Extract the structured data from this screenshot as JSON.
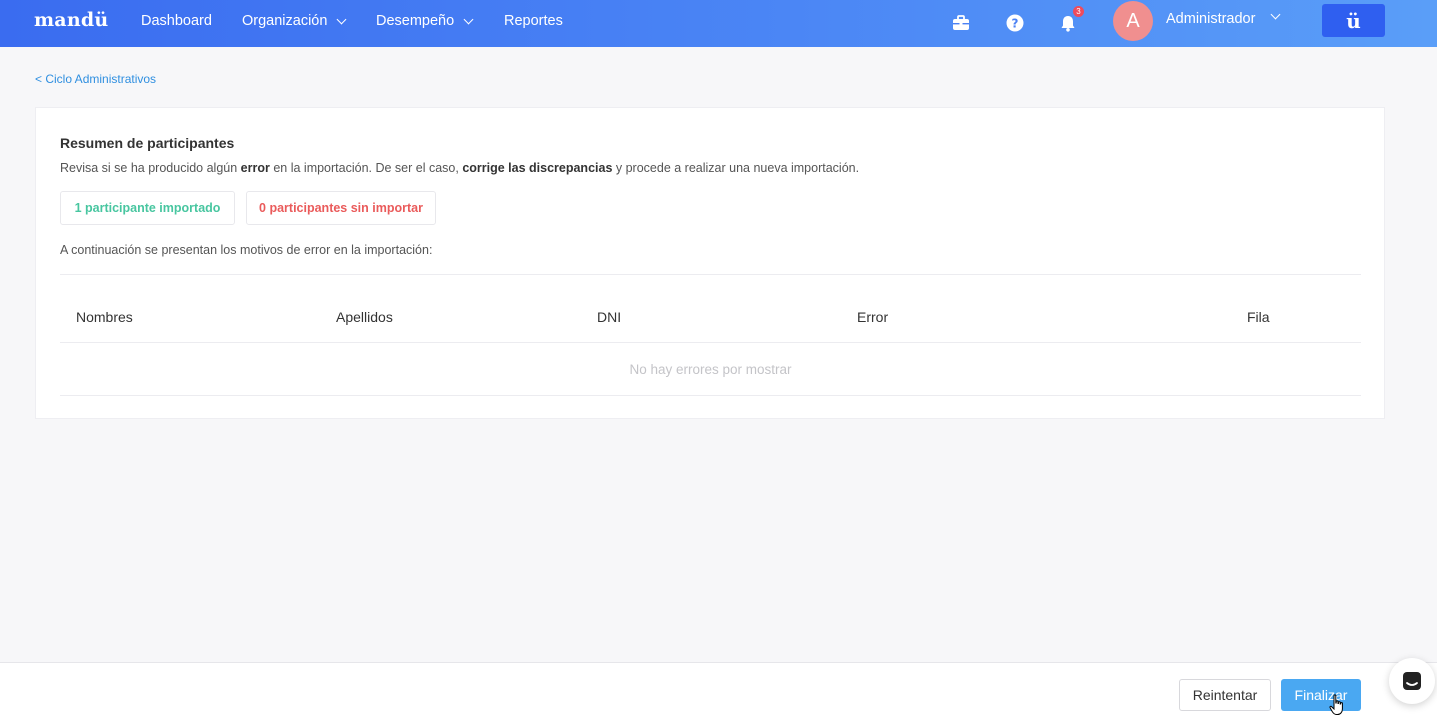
{
  "header": {
    "logo": "mandü",
    "nav": [
      {
        "label": "Dashboard"
      },
      {
        "label": "Organización"
      },
      {
        "label": "Desempeño"
      },
      {
        "label": "Reportes"
      }
    ],
    "notifications_count": "3",
    "avatar_initial": "A",
    "user_name": "Administrador",
    "brand_button": "ü",
    "colors": {
      "bar_start": "#3a6cf0",
      "bar_end": "#5a9ef8",
      "brand_btn": "#2f5ff0",
      "avatar": "#f08f8f"
    }
  },
  "breadcrumb": "< Ciclo Administrativos",
  "summary": {
    "title": "Resumen de participantes",
    "desc_1": "Revisa si se ha producido algún ",
    "desc_bold_1": "error",
    "desc_2": " en la importación. De ser el caso, ",
    "desc_bold_2": "corrige las discrepancias",
    "desc_3": " y procede a realizar una nueva importación.",
    "imported": "1 participante importado",
    "not_imported": "0 participantes sin importar",
    "subtitle": "A continuación se presentan los motivos de error en la importación:",
    "colors": {
      "imported": "#48c6a0",
      "not_imported": "#ea5b5b"
    }
  },
  "table": {
    "columns": [
      "Nombres",
      "Apellidos",
      "DNI",
      "Error",
      "Fila"
    ],
    "empty": "No hay errores por mostrar"
  },
  "footer": {
    "retry": "Reintentar",
    "finish": "Finalizar",
    "colors": {
      "finish": "#4aa8f2"
    }
  },
  "icons": [
    "briefcase-icon",
    "help-icon",
    "bell-icon",
    "chevron-down-icon",
    "chat-icon",
    "hand-cursor-icon"
  ]
}
